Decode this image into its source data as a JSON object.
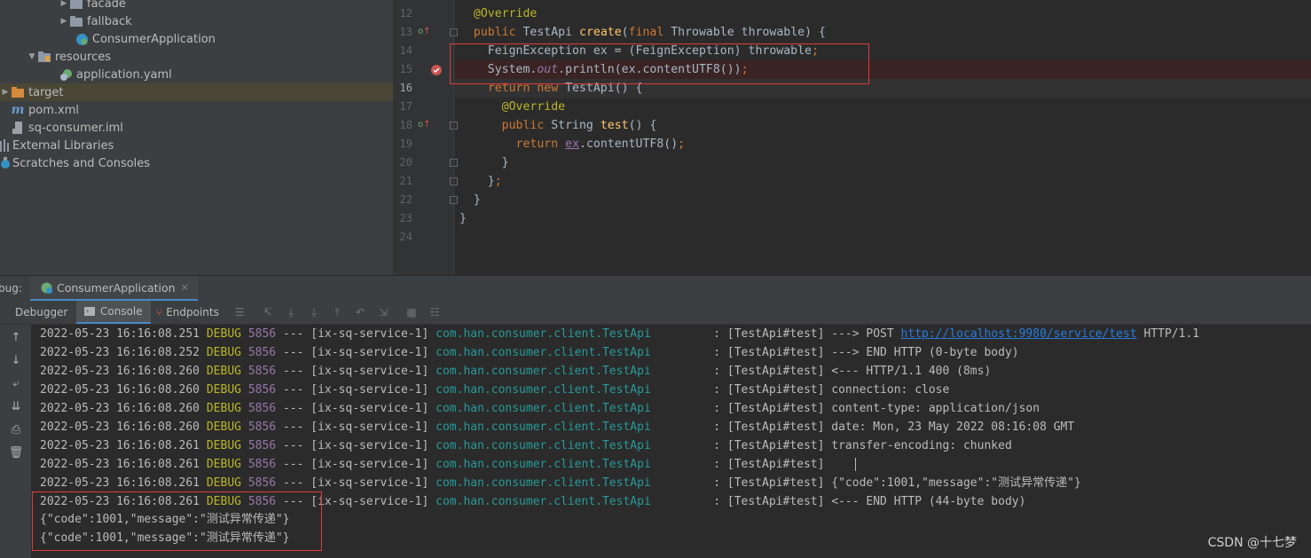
{
  "colors": {
    "keyword": "#cc7832",
    "annotation": "#bbb529",
    "method": "#ffc66d",
    "field": "#9876aa",
    "class": "#299999",
    "link": "#287bde",
    "highlight_border": "#e03c3c"
  },
  "project_tree": {
    "items": [
      {
        "label": "facade",
        "icon": "folder-icon"
      },
      {
        "label": "fallback",
        "icon": "folder-icon"
      },
      {
        "label": "ConsumerApplication",
        "icon": "spring-class-icon"
      },
      {
        "label": "resources",
        "icon": "resources-folder-icon"
      },
      {
        "label": "application.yaml",
        "icon": "yaml-file-icon"
      },
      {
        "label": "target",
        "icon": "folder-icon"
      },
      {
        "label": "pom.xml",
        "icon": "maven-icon"
      },
      {
        "label": "sq-consumer.iml",
        "icon": "iml-file-icon"
      },
      {
        "label": "External Libraries",
        "icon": "library-icon"
      },
      {
        "label": "Scratches and Consoles",
        "icon": "scratch-icon"
      }
    ]
  },
  "editor": {
    "line_numbers": [
      "12",
      "13",
      "14",
      "15",
      "16",
      "17",
      "18",
      "19",
      "20",
      "21",
      "22",
      "23",
      "24"
    ]
  },
  "debug": {
    "label": "bug:",
    "session_tab": "ConsumerApplication",
    "tabs": {
      "debugger": "Debugger",
      "console": "Console",
      "endpoints": "Endpoints"
    }
  },
  "console": {
    "lines": [
      {
        "ts": "2022-05-23 16:16:08.251",
        "level": "DEBUG",
        "pid": "5856",
        "thread": "--- [ix-sq-service-1]",
        "logger": "com.han.consumer.client.TestApi",
        "sep": "         : ",
        "msg_pre": "[TestApi#test] ---> POST ",
        "url": "http://localhost:9980/service/test",
        "msg_post": " HTTP/1.1"
      },
      {
        "ts": "2022-05-23 16:16:08.252",
        "level": "DEBUG",
        "pid": "5856",
        "thread": "--- [ix-sq-service-1]",
        "logger": "com.han.consumer.client.TestApi",
        "sep": "         : ",
        "msg_pre": "[TestApi#test] ---> END HTTP (0-byte body)",
        "url": "",
        "msg_post": ""
      },
      {
        "ts": "2022-05-23 16:16:08.260",
        "level": "DEBUG",
        "pid": "5856",
        "thread": "--- [ix-sq-service-1]",
        "logger": "com.han.consumer.client.TestApi",
        "sep": "         : ",
        "msg_pre": "[TestApi#test] <--- HTTP/1.1 400 (8ms)",
        "url": "",
        "msg_post": ""
      },
      {
        "ts": "2022-05-23 16:16:08.260",
        "level": "DEBUG",
        "pid": "5856",
        "thread": "--- [ix-sq-service-1]",
        "logger": "com.han.consumer.client.TestApi",
        "sep": "         : ",
        "msg_pre": "[TestApi#test] connection: close",
        "url": "",
        "msg_post": ""
      },
      {
        "ts": "2022-05-23 16:16:08.260",
        "level": "DEBUG",
        "pid": "5856",
        "thread": "--- [ix-sq-service-1]",
        "logger": "com.han.consumer.client.TestApi",
        "sep": "         : ",
        "msg_pre": "[TestApi#test] content-type: application/json",
        "url": "",
        "msg_post": ""
      },
      {
        "ts": "2022-05-23 16:16:08.260",
        "level": "DEBUG",
        "pid": "5856",
        "thread": "--- [ix-sq-service-1]",
        "logger": "com.han.consumer.client.TestApi",
        "sep": "         : ",
        "msg_pre": "[TestApi#test] date: Mon, 23 May 2022 08:16:08 GMT",
        "url": "",
        "msg_post": ""
      },
      {
        "ts": "2022-05-23 16:16:08.261",
        "level": "DEBUG",
        "pid": "5856",
        "thread": "--- [ix-sq-service-1]",
        "logger": "com.han.consumer.client.TestApi",
        "sep": "         : ",
        "msg_pre": "[TestApi#test] transfer-encoding: chunked",
        "url": "",
        "msg_post": ""
      },
      {
        "ts": "2022-05-23 16:16:08.261",
        "level": "DEBUG",
        "pid": "5856",
        "thread": "--- [ix-sq-service-1]",
        "logger": "com.han.consumer.client.TestApi",
        "sep": "         : ",
        "msg_pre": "[TestApi#test] ",
        "url": "",
        "msg_post": ""
      },
      {
        "ts": "2022-05-23 16:16:08.261",
        "level": "DEBUG",
        "pid": "5856",
        "thread": "--- [ix-sq-service-1]",
        "logger": "com.han.consumer.client.TestApi",
        "sep": "         : ",
        "msg_pre": "[TestApi#test] {\"code\":1001,\"message\":\"测试异常传递\"}",
        "url": "",
        "msg_post": ""
      },
      {
        "ts": "2022-05-23 16:16:08.261",
        "level": "DEBUG",
        "pid": "5856",
        "thread": "--- [ix-sq-service-1]",
        "logger": "com.han.consumer.client.TestApi",
        "sep": "         : ",
        "msg_pre": "[TestApi#test] <--- END HTTP (44-byte body)",
        "url": "",
        "msg_post": ""
      }
    ],
    "plain_lines": [
      "{\"code\":1001,\"message\":\"测试异常传递\"}",
      "{\"code\":1001,\"message\":\"测试异常传递\"}"
    ]
  },
  "watermark": "CSDN @十七梦"
}
